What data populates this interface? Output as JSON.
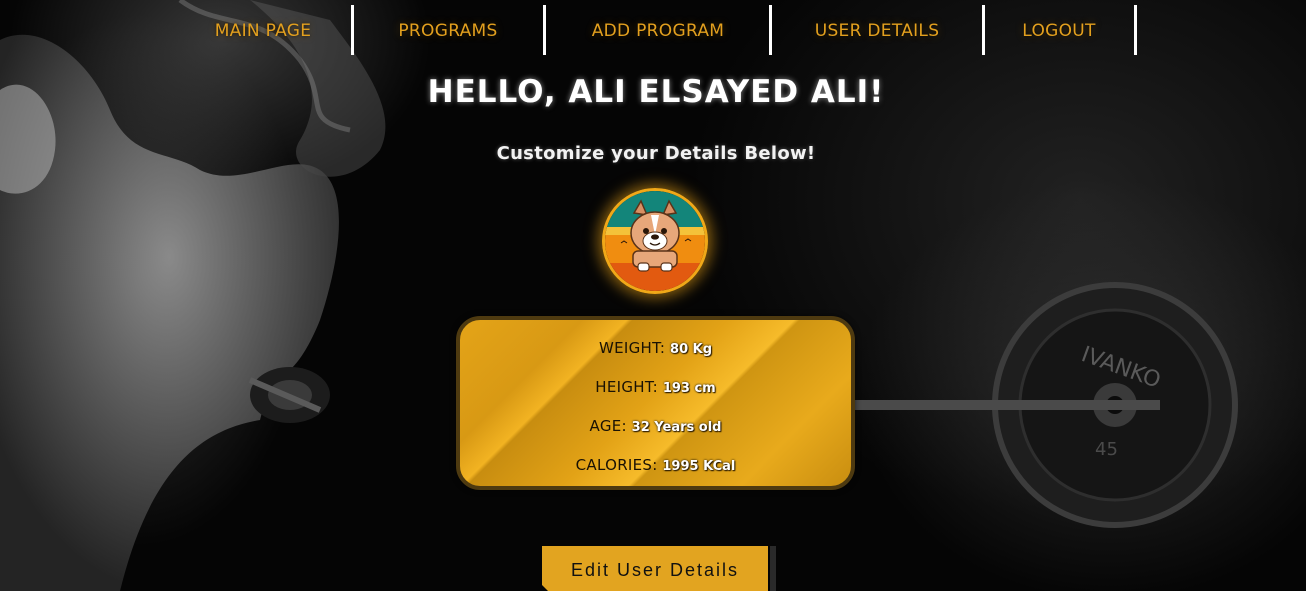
{
  "nav": {
    "items": [
      {
        "label": "MAIN PAGE"
      },
      {
        "label": "PROGRAMS"
      },
      {
        "label": "ADD PROGRAM"
      },
      {
        "label": "USER DETAILS"
      },
      {
        "label": "LOGOUT"
      }
    ]
  },
  "header": {
    "greeting": "HELLO, ALI ELSAYED ALI!",
    "subtitle": "Customize your Details Below!"
  },
  "profile": {
    "avatar_icon": "bulldog-avatar-icon"
  },
  "details": {
    "weight_label": "WEIGHT:",
    "weight_value": "80 Kg",
    "height_label": "HEIGHT:",
    "height_value": "193 cm",
    "age_label": "AGE:",
    "age_value": "32 Years old",
    "calories_label": "CALORIES:",
    "calories_value": "1995 KCal"
  },
  "actions": {
    "edit_label": "Edit User Details"
  },
  "colors": {
    "accent": "#e3a01e",
    "card_gold": "#e4a418",
    "text_white": "#ffffff"
  }
}
